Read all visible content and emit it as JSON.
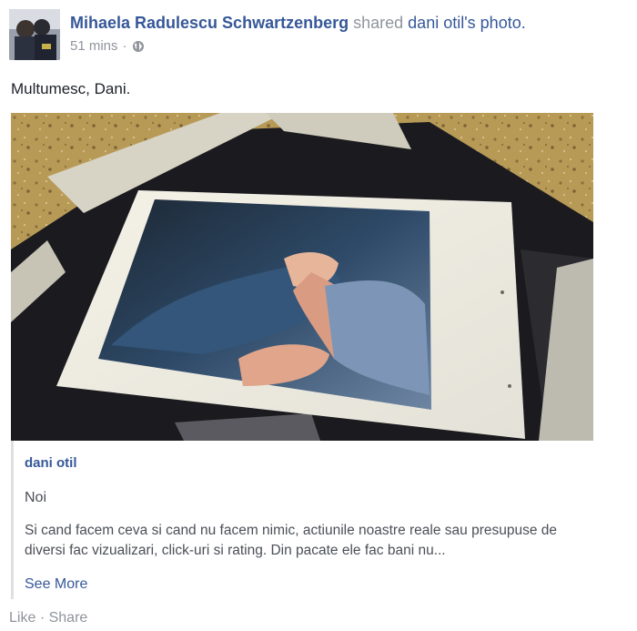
{
  "post": {
    "author": "Mihaela Radulescu Schwartzenberg",
    "shared_text": "shared",
    "original_author_possessive": "dani otil's",
    "object_word": "photo.",
    "timestamp": "51 mins",
    "separator": "·",
    "privacy_icon": "globe-icon",
    "status_text": "Multumesc, Dani."
  },
  "attachment": {
    "author": "dani otil",
    "title": "Noi",
    "body": "Si cand facem ceva si cand nu facem nimic, actiunile noastre reale sau presupuse de diversi fac vizualizari, click-uri si rating. Din pacate ele fac bani nu...",
    "see_more": "See More"
  },
  "actions": {
    "like": "Like",
    "separator": "·",
    "share": "Share"
  },
  "colors": {
    "link": "#365899",
    "muted": "#90949c",
    "body_text": "#4b4f56",
    "attachment_border": "#dddfe2"
  }
}
